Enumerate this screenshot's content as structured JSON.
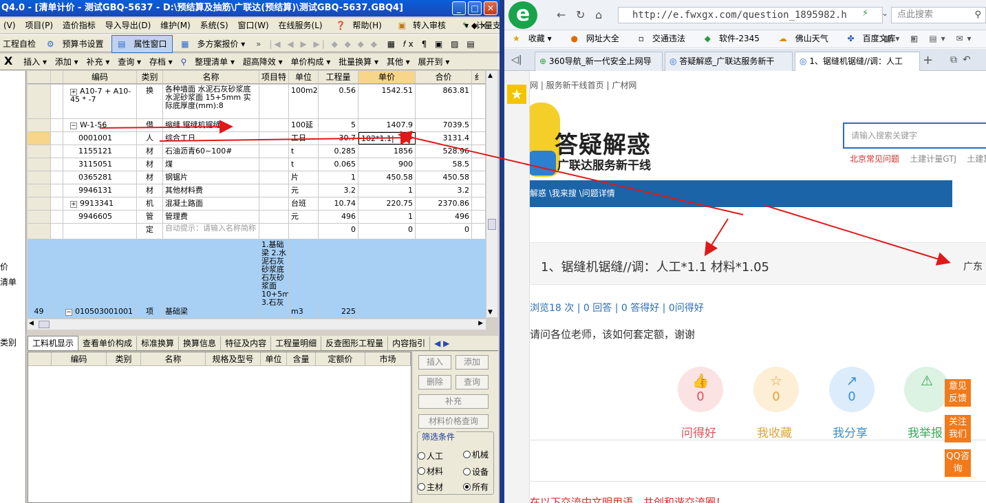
{
  "app": {
    "title": "Q4.0 - [清单计价 - 测试GBQ-5637 - D:\\预结算及抽筋\\广联达(预结算)\\测试GBQ-5637.GBQ4]",
    "win_buttons": [
      "_",
      "□",
      "X"
    ],
    "menu": [
      "(V)",
      "项目(P)",
      "造价指标",
      "导入导出(D)",
      "维护(M)",
      "系统(S)",
      "窗口(W)",
      "在线服务(L)",
      "帮助(H)",
      "转入审核",
      "计量支付"
    ],
    "menu_right": [
      "▾",
      "◆",
      "×"
    ],
    "toolbar1": {
      "a": "工程自检",
      "b": "预算书设置",
      "c": "属性窗口",
      "d": "多方案报价 ▾"
    },
    "toolbar2": [
      "插入 ▾",
      "添加 ▾",
      "补充 ▾",
      "查询 ▾",
      "存档 ▾",
      "整理清单 ▾",
      "超高降效 ▾",
      "单价构成 ▾",
      "批量换算 ▾",
      "其他 ▾",
      "展开到 ▾"
    ],
    "close_x": "X",
    "left_labels": [
      "价",
      "清单",
      "类别"
    ],
    "grid": {
      "headers": [
        "编码",
        "类别",
        "名称",
        "项目特",
        "单位",
        "工程量",
        "单价",
        "合价"
      ],
      "rows": [
        {
          "code": "A10-7 + A10-45 * -7",
          "type": "换",
          "name": "各种墙面 水泥石灰砂浆底 水泥砂浆面 15+5mm 实际底厚度(mm):8",
          "feat": "",
          "unit": "100m2",
          "qty": "0.56",
          "price": "1542.51",
          "total": "863.81"
        },
        {
          "code": "W-1-56",
          "type": "借",
          "name": "缩缝 锯缝机锯缝",
          "feat": "",
          "unit": "100延",
          "qty": "5",
          "price": "1407.9",
          "total": "7039.5"
        },
        {
          "code": "0001001",
          "type": "人",
          "name": "综合工日",
          "feat": "",
          "unit": "工日",
          "qty": "30.7",
          "price": "102*1.1|",
          "total": "3131.4"
        },
        {
          "code": "1155121",
          "type": "材",
          "name": "石油沥青60~100#",
          "feat": "",
          "unit": "t",
          "qty": "0.285",
          "price": "1856",
          "total": "528.96"
        },
        {
          "code": "3115051",
          "type": "材",
          "name": "煤",
          "feat": "",
          "unit": "t",
          "qty": "0.065",
          "price": "900",
          "total": "58.5"
        },
        {
          "code": "0365281",
          "type": "材",
          "name": "钢锯片",
          "feat": "",
          "unit": "片",
          "qty": "1",
          "price": "450.58",
          "total": "450.58"
        },
        {
          "code": "9946131",
          "type": "材",
          "name": "其他材料费",
          "feat": "",
          "unit": "元",
          "qty": "3.2",
          "price": "1",
          "total": "3.2"
        },
        {
          "code": "9913341",
          "type": "机",
          "name": "混凝土路面",
          "feat": "",
          "unit": "台班",
          "qty": "10.74",
          "price": "220.75",
          "total": "2370.86"
        },
        {
          "code": "9946605",
          "type": "管",
          "name": "管理费",
          "feat": "",
          "unit": "元",
          "qty": "496",
          "price": "1",
          "total": "496"
        },
        {
          "code": "",
          "type": "定",
          "name": "自动提示：请输入名称简称",
          "feat": "",
          "unit": "",
          "qty": "0",
          "price": "0",
          "total": "0"
        }
      ],
      "bottom_row": {
        "num": "49",
        "code": "010503001001",
        "type": "项",
        "name": "基础梁",
        "feat": "1.基础梁 2.水泥石灰砂浆底 石灰砂浆面 10+5mm 3.石灰",
        "unit": "m3",
        "qty": "225"
      }
    },
    "bottom_tabs": [
      "工料机显示",
      "查看单价构成",
      "标准换算",
      "换算信息",
      "特征及内容",
      "工程量明细",
      "反查图形工程量",
      "内容指引"
    ],
    "bottom_headers": [
      "编码",
      "类别",
      "名称",
      "规格及型号",
      "单位",
      "含量",
      "定额价",
      "市场"
    ],
    "side_buttons": {
      "insert": "插入",
      "add": "添加",
      "delete": "删除",
      "query": "查询",
      "supplement": "补充",
      "price_query": "材料价格查询"
    },
    "filter": {
      "title": "筛选条件",
      "opts": [
        "人工",
        "机械",
        "材料",
        "设备",
        "主材",
        "所有"
      ],
      "selected": "所有"
    }
  },
  "browser": {
    "url": "http://e.fwxgx.com/question_1895982.h",
    "search_placeholder": "点此搜索",
    "favorites": [
      "收藏 ▾",
      "网址大全",
      "交通违法",
      "软件-2345",
      "佛山天气",
      "百度文库",
      "»"
    ],
    "tabs": [
      "360导航_新一代安全上网导",
      "答疑解惑_广联达服务新干",
      "1、锯缝机锯缝//调：人工"
    ],
    "page": {
      "crumb": "网 | 服务新干线首页 | 广材网",
      "site_title": "答疑解惑",
      "site_sub": "广联达服务新干线",
      "search_placeholder": "请输入搜索关键字",
      "hotlinks": [
        "北京常见问题",
        "土建计量GTJ",
        "土建算"
      ],
      "nav": "解惑 \\我来搜 \\问题详情",
      "question_title": "1、锯缝机锯缝//调：人工*1.1 材料*1.05",
      "location": "广东",
      "stats": "浏览18 次 | 0 回答 | 0 答得好 | 0问得好",
      "body": "请问各位老师，该如何套定额，谢谢",
      "actions": [
        {
          "label": "问得好",
          "count": "0",
          "color": "#e0545a",
          "bg": "#fbe3e4",
          "icon": "thumbs-up-icon",
          "glyph": "👍"
        },
        {
          "label": "我收藏",
          "count": "0",
          "color": "#e2a33a",
          "bg": "#fcefd6",
          "icon": "star-icon",
          "glyph": "☆"
        },
        {
          "label": "我分享",
          "count": "0",
          "color": "#3a8fd6",
          "bg": "#dcecfa",
          "icon": "share-icon",
          "glyph": "↗"
        },
        {
          "label": "我举报",
          "count": "",
          "color": "#3aa85a",
          "bg": "#dcf2e2",
          "icon": "warning-icon",
          "glyph": "⚠"
        }
      ],
      "side_buttons": [
        "意见反馈",
        "关注我们",
        "QQ咨询"
      ],
      "footer": "在以下交流中文明用语，共创和谐交流圈！"
    }
  }
}
